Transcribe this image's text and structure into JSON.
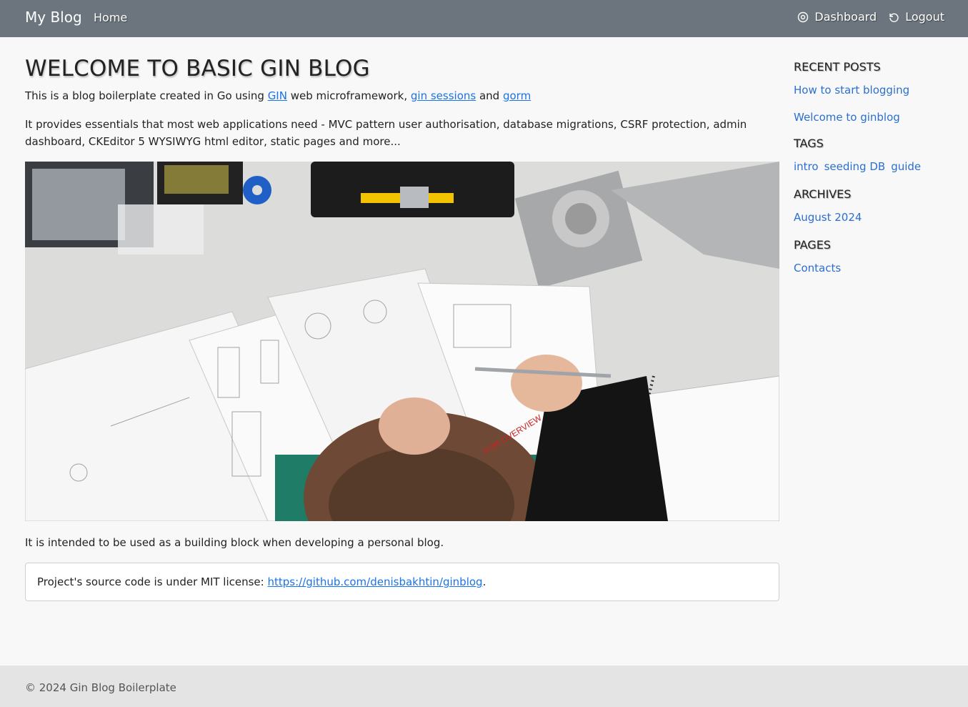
{
  "nav": {
    "brand": "My Blog",
    "home": "Home",
    "dashboard": "Dashboard",
    "logout": "Logout"
  },
  "main": {
    "title": "WELCOME TO BASIC GIN BLOG",
    "intro_prefix": "This is a blog boilerplate created in Go using ",
    "link_gin": "GIN",
    "intro_mid1": " web microframework, ",
    "link_sessions": "gin sessions",
    "intro_mid2": " and ",
    "link_gorm": "gorm",
    "description": "It provides essentials that most web applications need - MVC pattern user authorisation, database migrations, CSRF protection, admin dashboard, CKEditor 5 WYSIWYG html editor, static pages and more...",
    "purpose": "It is intended to be used as a building block when developing a personal blog.",
    "license_prefix": "Project's source code is under MIT license: ",
    "license_link": "https://github.com/denisbakhtin/ginblog",
    "license_suffix": ".",
    "hero_stamp_text": "FOR OVERVIEW"
  },
  "sidebar": {
    "recent_heading": "RECENT POSTS",
    "recent": [
      "How to start blogging",
      "Welcome to ginblog"
    ],
    "tags_heading": "TAGS",
    "tags": [
      "intro",
      "seeding DB",
      "guide"
    ],
    "archives_heading": "ARCHIVES",
    "archives": [
      "August 2024"
    ],
    "pages_heading": "PAGES",
    "pages": [
      "Contacts"
    ]
  },
  "footer": {
    "text": "© 2024 Gin Blog Boilerplate"
  },
  "colors": {
    "navbar": "#6c757d",
    "link": "#2b6fd1",
    "footer": "#e4e4e4"
  }
}
